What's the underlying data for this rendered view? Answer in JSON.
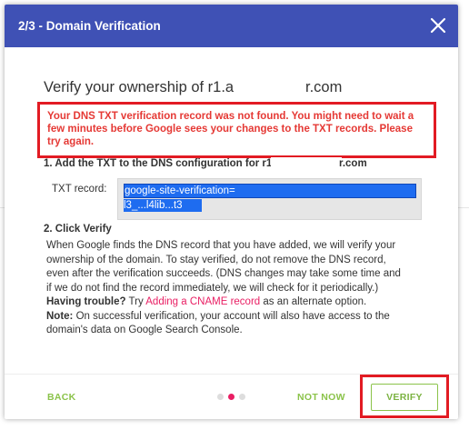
{
  "dialog": {
    "title": "2/3 - Domain Verification"
  },
  "heading": {
    "prefix": "Verify your ownership of r1.a",
    "suffix": "r.com"
  },
  "error": {
    "message": "Your DNS TXT verification record was not found. You might need to wait a few minutes before Google sees your changes to the TXT records. Please try again."
  },
  "step1": {
    "prefix": "1. Add the TXT to the DNS configuration for r1.a",
    "suffix": "r.com",
    "txt_label": "TXT record:",
    "txt_value_line1": "google-site-verification=",
    "txt_value_line2": "l3_...l4lib...t3"
  },
  "step2": {
    "title": "2. Click Verify",
    "lines": [
      "When Google finds the DNS record that you have added, we will verify your",
      "ownership of the domain. To stay verified, do not remove the DNS record,",
      "even after the verification succeeds. (DNS changes may take some time and",
      "if we do not find the record immediately, we will check for it periodically.)"
    ],
    "trouble_label": "Having trouble?",
    "trouble_try": " Try ",
    "trouble_link": "Adding a CNAME record",
    "trouble_tail": " as an alternate option.",
    "note_label": "Note:",
    "note_line1": " On successful verification, your account will also have access to the",
    "note_line2": "domain's data on Google Search Console."
  },
  "footer": {
    "back_label": "BACK",
    "not_now_label": "NOT NOW",
    "verify_label": "VERIFY",
    "dots": [
      {
        "color": "#dddddd"
      },
      {
        "color": "#e91e63"
      },
      {
        "color": "#dddddd"
      }
    ]
  },
  "colors": {
    "header": "#3f51b5",
    "error": "#e53935",
    "highlight": "#e21b23",
    "button": "#8bc34a",
    "link": "#e91e63"
  }
}
